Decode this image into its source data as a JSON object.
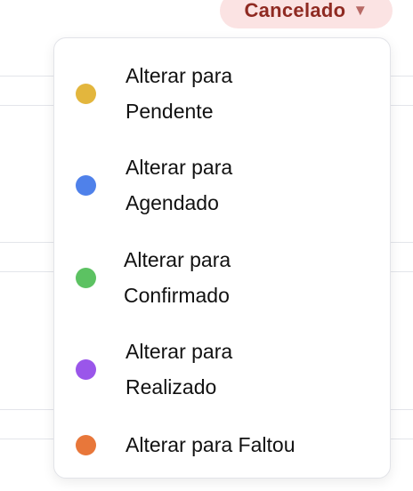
{
  "status_badge": {
    "label": "Cancelado",
    "caret": "▼",
    "background": "#fbe3e3",
    "color": "#8f2a22"
  },
  "menu": {
    "items": [
      {
        "label": "Alterar para Pendente",
        "color": "#e3b63d"
      },
      {
        "label": "Alterar para Agendado",
        "color": "#4f81ea"
      },
      {
        "label": "Alterar para Confirmado",
        "color": "#5cc262"
      },
      {
        "label": "Alterar para Realizado",
        "color": "#9a56ea"
      },
      {
        "label": "Alterar para Faltou",
        "color": "#e8773a"
      }
    ]
  }
}
